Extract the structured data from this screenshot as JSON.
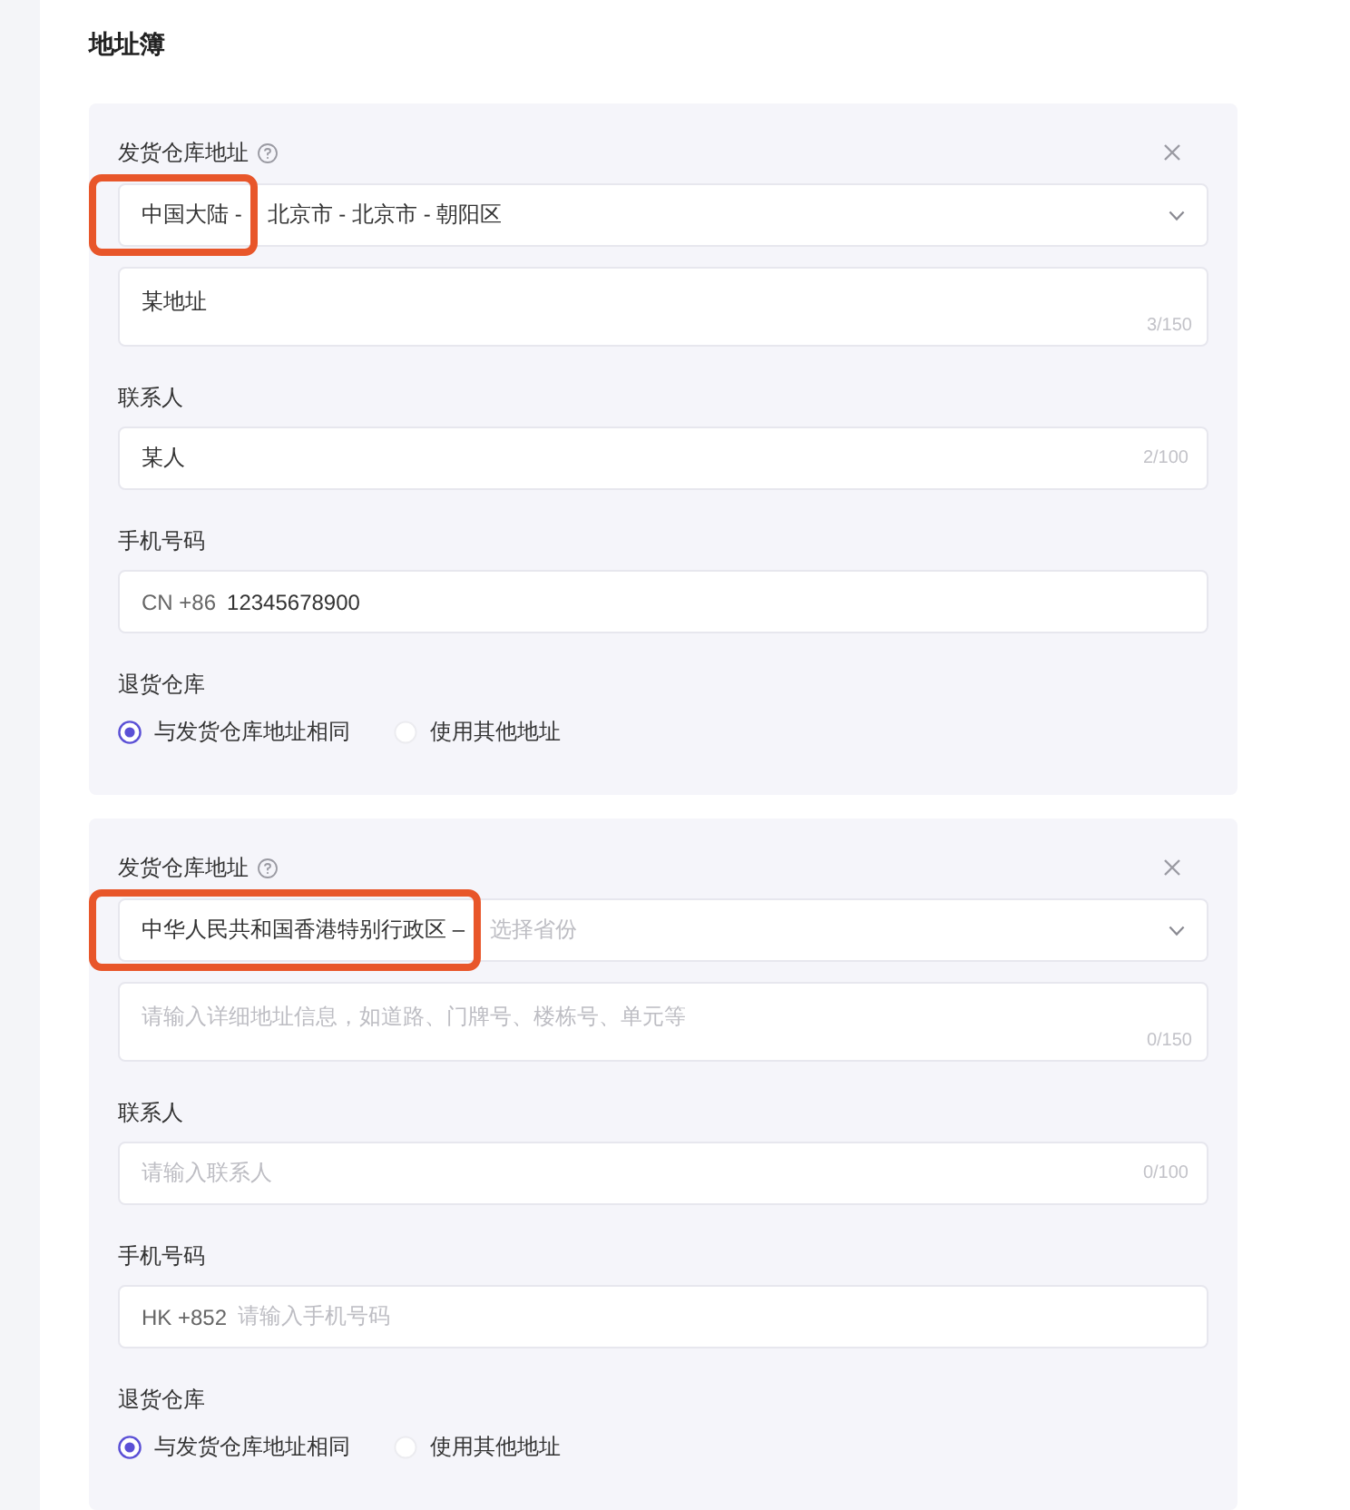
{
  "title": "地址簿",
  "addresses": [
    {
      "region_label": "发货仓库地址",
      "region": {
        "country": "中国大陆 -",
        "value": "北京市 - 北京市 - 朝阳区",
        "highlighted": true
      },
      "address": {
        "value": "某地址",
        "counter": "3/150"
      },
      "contact_label": "联系人",
      "contact": {
        "value": "某人",
        "counter": "2/100"
      },
      "phone_label": "手机号码",
      "phone": {
        "prefix": "CN +86",
        "value": "12345678900"
      },
      "return_label": "退货仓库",
      "return_options": [
        {
          "label": "与发货仓库地址相同",
          "selected": true
        },
        {
          "label": "使用其他地址",
          "selected": false
        }
      ]
    },
    {
      "region_label": "发货仓库地址",
      "region": {
        "country": "中华人民共和国香港特别行政区 –",
        "placeholder": "选择省份",
        "highlighted": true
      },
      "address": {
        "placeholder": "请输入详细地址信息，如道路、门牌号、楼栋号、单元等",
        "counter": "0/150"
      },
      "contact_label": "联系人",
      "contact": {
        "placeholder": "请输入联系人",
        "counter": "0/100"
      },
      "phone_label": "手机号码",
      "phone": {
        "prefix": "HK +852",
        "placeholder": "请输入手机号码"
      },
      "return_label": "退货仓库",
      "return_options": [
        {
          "label": "与发货仓库地址相同",
          "selected": true
        },
        {
          "label": "使用其他地址",
          "selected": false
        }
      ]
    }
  ]
}
